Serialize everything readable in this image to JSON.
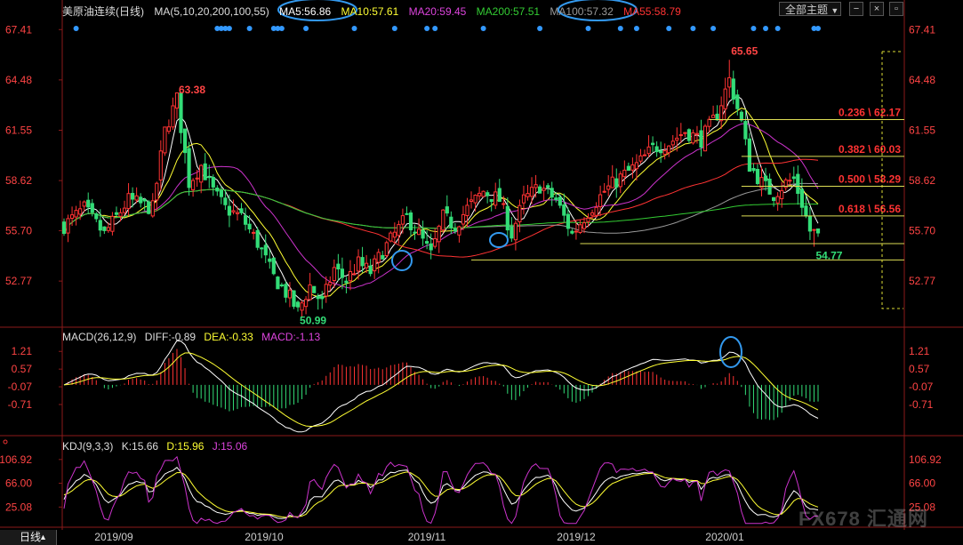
{
  "header": {
    "symbol": "美原油连续",
    "period": "日线",
    "ma_label": "MA(5,10,20,200,100,55)",
    "ma5": "MA5:56.86",
    "ma10": "MA10:57.61",
    "ma20": "MA20:59.45",
    "ma200": "MA200:57.51",
    "ma100": "MA100:57.32",
    "ma55": "MA55:58.79",
    "theme_button": "全部主题",
    "theme_arrow": "▼",
    "colors": {
      "ma5": "#ffffff",
      "ma10": "#ffff33",
      "ma20": "#cc33cc",
      "ma200": "#33cc33",
      "ma100": "#999999",
      "ma55": "#ff3333"
    }
  },
  "macd_header": {
    "label": "MACD(26,12,9)",
    "diff": "DIFF:-0.89",
    "dea": "DEA:-0.33",
    "macd": "MACD:-1.13"
  },
  "kdj_header": {
    "label": "KDJ(9,3,3)",
    "k": "K:15.66",
    "d": "D:15.96",
    "j": "J:15.06"
  },
  "period_tab": "日线",
  "watermark": "FX678 汇通网",
  "chart_data": [
    {
      "type": "candlestick",
      "name": "price",
      "y_ticks": [
        "67.41",
        "64.48",
        "61.55",
        "58.62",
        "55.70",
        "52.77"
      ],
      "y_tick_values": [
        67.41,
        64.48,
        61.55,
        58.62,
        55.7,
        52.77
      ],
      "ylim": [
        50.5,
        68.2
      ],
      "x_ticks": [
        "2019/09",
        "2019/10",
        "2019/11",
        "2019/12",
        "2020/01"
      ],
      "annotations": [
        {
          "text": "63.38",
          "value": 63.38
        },
        {
          "text": "50.99",
          "value": 50.99
        },
        {
          "text": "65.65",
          "value": 65.65
        },
        {
          "text": "54.77",
          "value": 54.77
        }
      ],
      "fib_levels": [
        {
          "text": "0.236 \\ 62.17",
          "value": 62.17
        },
        {
          "text": "0.382 \\ 60.03",
          "value": 60.03
        },
        {
          "text": "0.500 \\ 58.29",
          "value": 58.29
        },
        {
          "text": "0.618 \\ 56.56",
          "value": 56.56
        }
      ],
      "support_levels": [
        54.95,
        54.0
      ],
      "keypoints": [
        [
          0,
          56.0
        ],
        [
          5,
          57.0
        ],
        [
          10,
          55.5
        ],
        [
          16,
          57.5
        ],
        [
          22,
          57.0
        ],
        [
          25,
          61.5
        ],
        [
          28,
          63.38
        ],
        [
          31,
          58.5
        ],
        [
          34,
          59.5
        ],
        [
          37,
          58.0
        ],
        [
          40,
          57.0
        ],
        [
          44,
          56.5
        ],
        [
          48,
          55.0
        ],
        [
          52,
          53.0
        ],
        [
          56,
          51.8
        ],
        [
          58,
          50.99
        ],
        [
          61,
          52.5
        ],
        [
          64,
          51.5
        ],
        [
          67,
          53.5
        ],
        [
          70,
          52.8
        ],
        [
          73,
          53.8
        ],
        [
          76,
          53.3
        ],
        [
          79,
          54.5
        ],
        [
          82,
          55.5
        ],
        [
          85,
          56.5
        ],
        [
          88,
          55.5
        ],
        [
          91,
          54.3
        ],
        [
          94,
          56.5
        ],
        [
          97,
          56.0
        ],
        [
          100,
          57.0
        ],
        [
          104,
          58.0
        ],
        [
          108,
          57.5
        ],
        [
          111,
          55.5
        ],
        [
          114,
          57.5
        ],
        [
          118,
          58.3
        ],
        [
          122,
          57.5
        ],
        [
          126,
          55.5
        ],
        [
          130,
          56.8
        ],
        [
          134,
          58.0
        ],
        [
          138,
          58.8
        ],
        [
          142,
          59.5
        ],
        [
          146,
          60.5
        ],
        [
          150,
          60.8
        ],
        [
          154,
          61.5
        ],
        [
          158,
          61.0
        ],
        [
          162,
          62.5
        ],
        [
          165,
          64.5
        ],
        [
          168,
          62.0
        ],
        [
          170,
          59.5
        ],
        [
          173,
          58.5
        ],
        [
          176,
          57.8
        ],
        [
          179,
          58.5
        ],
        [
          181,
          58.7
        ],
        [
          183,
          57.3
        ],
        [
          185,
          55.7
        ],
        [
          187,
          55.5
        ]
      ],
      "last_close": 55.57
    },
    {
      "type": "bar",
      "name": "macd",
      "y_ticks": [
        "1.21",
        "0.57",
        "-0.07",
        "-0.71"
      ],
      "y_tick_values": [
        1.21,
        0.57,
        -0.07,
        -0.71
      ],
      "ylim": [
        -1.9,
        1.7
      ]
    },
    {
      "type": "line",
      "name": "kdj",
      "y_ticks": [
        "106.92",
        "66.00",
        "25.08"
      ],
      "y_tick_values": [
        106.92,
        66.0,
        25.08
      ],
      "ylim": [
        -5,
        125
      ]
    }
  ]
}
